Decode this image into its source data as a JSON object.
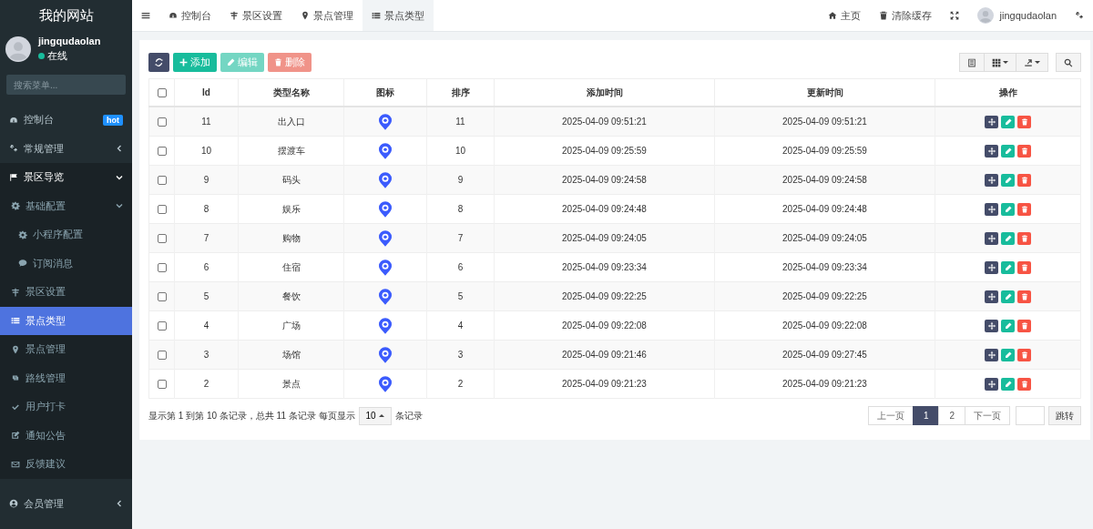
{
  "sidebar": {
    "site_title": "我的网站",
    "user": {
      "name": "jingqudaolan",
      "status": "在线",
      "online": true
    },
    "search": {
      "placeholder": "搜索菜单..."
    },
    "items": [
      {
        "label": "控制台",
        "badge": "hot",
        "selected": false
      },
      {
        "label": "常规管理",
        "expanded": false,
        "selected": false
      },
      {
        "label": "景区导览",
        "expanded": true,
        "selected": false,
        "children": [
          {
            "label": "基础配置",
            "expanded": true,
            "selected": false,
            "children": [
              {
                "label": "小程序配置",
                "selected": false
              },
              {
                "label": "订阅消息",
                "selected": false
              }
            ]
          },
          {
            "label": "景区设置",
            "selected": false
          },
          {
            "label": "景点类型",
            "selected": true
          },
          {
            "label": "景点管理",
            "selected": false
          },
          {
            "label": "路线管理",
            "selected": false
          },
          {
            "label": "用户打卡",
            "selected": false
          },
          {
            "label": "通知公告",
            "selected": false
          },
          {
            "label": "反馈建议",
            "selected": false
          }
        ]
      },
      {
        "label": "会员管理",
        "expanded": false,
        "selected": false
      }
    ]
  },
  "topbar": {
    "tabs": [
      {
        "label": "控制台",
        "selected": false
      },
      {
        "label": "景区设置",
        "selected": false
      },
      {
        "label": "景点管理",
        "selected": false
      },
      {
        "label": "景点类型",
        "selected": true
      }
    ],
    "links": [
      "主页",
      "清除缓存"
    ],
    "user": "jingqudaolan"
  },
  "toolbar": {
    "buttons": [
      {
        "kind": "refresh"
      },
      {
        "kind": "add",
        "label": "添加",
        "disabled": false
      },
      {
        "kind": "edit",
        "label": "编辑",
        "disabled": true
      },
      {
        "kind": "delete",
        "label": "删除",
        "disabled": true
      }
    ]
  },
  "table": {
    "select_all": {
      "checked": false
    },
    "columns": [
      "Id",
      "类型名称",
      "图标",
      "排序",
      "添加时间",
      "更新时间",
      "操作"
    ],
    "rows": [
      {
        "checked": false,
        "id": "11",
        "name": "出入口",
        "sort": "11",
        "created": "2025-04-09 09:51:21",
        "updated": "2025-04-09 09:51:21"
      },
      {
        "checked": false,
        "id": "10",
        "name": "摆渡车",
        "sort": "10",
        "created": "2025-04-09 09:25:59",
        "updated": "2025-04-09 09:25:59"
      },
      {
        "checked": false,
        "id": "9",
        "name": "码头",
        "sort": "9",
        "created": "2025-04-09 09:24:58",
        "updated": "2025-04-09 09:24:58"
      },
      {
        "checked": false,
        "id": "8",
        "name": "娱乐",
        "sort": "8",
        "created": "2025-04-09 09:24:48",
        "updated": "2025-04-09 09:24:48"
      },
      {
        "checked": false,
        "id": "7",
        "name": "购物",
        "sort": "7",
        "created": "2025-04-09 09:24:05",
        "updated": "2025-04-09 09:24:05"
      },
      {
        "checked": false,
        "id": "6",
        "name": "住宿",
        "sort": "6",
        "created": "2025-04-09 09:23:34",
        "updated": "2025-04-09 09:23:34"
      },
      {
        "checked": false,
        "id": "5",
        "name": "餐饮",
        "sort": "5",
        "created": "2025-04-09 09:22:25",
        "updated": "2025-04-09 09:22:25"
      },
      {
        "checked": false,
        "id": "4",
        "name": "广场",
        "sort": "4",
        "created": "2025-04-09 09:22:08",
        "updated": "2025-04-09 09:22:08"
      },
      {
        "checked": false,
        "id": "3",
        "name": "场馆",
        "sort": "3",
        "created": "2025-04-09 09:21:46",
        "updated": "2025-04-09 09:27:45"
      },
      {
        "checked": false,
        "id": "2",
        "name": "景点",
        "sort": "2",
        "created": "2025-04-09 09:21:23",
        "updated": "2025-04-09 09:21:23"
      }
    ]
  },
  "footer": {
    "summary": "显示第 1 到第 10 条记录，总共 11 条记录 每页显示",
    "page_size": "10",
    "summary_end": "条记录",
    "pages": [
      {
        "label": "上一页",
        "kind": "prev",
        "selected": false
      },
      {
        "label": "1",
        "kind": "page",
        "selected": true
      },
      {
        "label": "2",
        "kind": "page",
        "selected": false
      },
      {
        "label": "下一页",
        "kind": "next",
        "selected": false
      }
    ],
    "jump": "跳转"
  }
}
